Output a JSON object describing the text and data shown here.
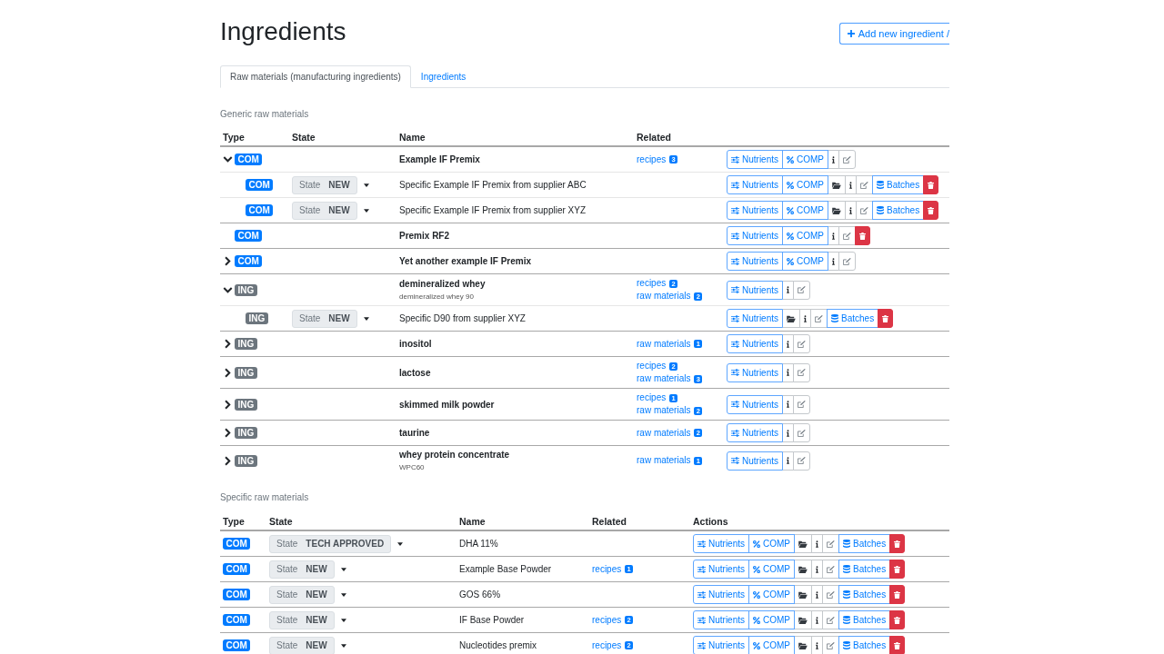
{
  "page": {
    "title": "Ingredients",
    "add_button": "Add new ingredient /"
  },
  "tabs": [
    {
      "label": "Raw materials (manufacturing ingredients)",
      "selected": true
    },
    {
      "label": "Ingredients",
      "selected": false
    }
  ],
  "generic": {
    "title": "Generic raw materials",
    "columns": [
      "Type",
      "State",
      "Name",
      "Related"
    ],
    "rows": [
      {
        "badge": {
          "text": "COM",
          "color": "#007bff"
        },
        "expanded": true,
        "name": "Example IF Premix",
        "related": [
          {
            "label": "recipes",
            "count": "3"
          }
        ],
        "actions": [
          {
            "kind": "nutrients",
            "label": "Nutrients"
          },
          {
            "kind": "comp",
            "label": "COMP"
          },
          {
            "kind": "info"
          },
          {
            "kind": "edit"
          }
        ],
        "children": [
          {
            "badge": {
              "text": "COM",
              "color": "#007bff"
            },
            "state": {
              "label": "State",
              "value": "NEW"
            },
            "name": "Specific Example IF Premix from supplier ABC",
            "actions": [
              {
                "kind": "nutrients",
                "label": "Nutrients"
              },
              {
                "kind": "comp",
                "label": "COMP"
              },
              {
                "kind": "folder"
              },
              {
                "kind": "info"
              },
              {
                "kind": "edit"
              },
              {
                "kind": "batches",
                "label": "Batches"
              },
              {
                "kind": "delete"
              }
            ]
          },
          {
            "badge": {
              "text": "COM",
              "color": "#007bff"
            },
            "state": {
              "label": "State",
              "value": "NEW"
            },
            "name": "Specific Example IF Premix from supplier XYZ",
            "actions": [
              {
                "kind": "nutrients",
                "label": "Nutrients"
              },
              {
                "kind": "comp",
                "label": "COMP"
              },
              {
                "kind": "folder"
              },
              {
                "kind": "info"
              },
              {
                "kind": "edit"
              },
              {
                "kind": "batches",
                "label": "Batches"
              },
              {
                "kind": "delete"
              }
            ]
          }
        ]
      },
      {
        "badge": {
          "text": "COM",
          "color": "#007bff"
        },
        "name": "Premix RF2",
        "actions": [
          {
            "kind": "nutrients",
            "label": "Nutrients"
          },
          {
            "kind": "comp",
            "label": "COMP"
          },
          {
            "kind": "info"
          },
          {
            "kind": "edit"
          },
          {
            "kind": "delete"
          }
        ]
      },
      {
        "badge": {
          "text": "COM",
          "color": "#007bff"
        },
        "expanded": false,
        "name": "Yet another example IF Premix",
        "actions": [
          {
            "kind": "nutrients",
            "label": "Nutrients"
          },
          {
            "kind": "comp",
            "label": "COMP"
          },
          {
            "kind": "info"
          },
          {
            "kind": "edit"
          }
        ]
      },
      {
        "badge": {
          "text": "ING",
          "color": "#6c757d"
        },
        "expanded": true,
        "name": "demineralized whey",
        "note": "demineralized whey 90",
        "related": [
          {
            "label": "recipes",
            "count": "2"
          },
          {
            "label": "raw materials",
            "count": "2"
          }
        ],
        "actions": [
          {
            "kind": "nutrients",
            "label": "Nutrients"
          },
          {
            "kind": "info"
          },
          {
            "kind": "edit"
          }
        ],
        "children": [
          {
            "badge": {
              "text": "ING",
              "color": "#6c757d"
            },
            "state": {
              "label": "State",
              "value": "NEW"
            },
            "name": "Specific D90 from supplier XYZ",
            "actions": [
              {
                "kind": "nutrients",
                "label": "Nutrients"
              },
              {
                "kind": "folder"
              },
              {
                "kind": "info"
              },
              {
                "kind": "edit"
              },
              {
                "kind": "batches",
                "label": "Batches"
              },
              {
                "kind": "delete"
              }
            ]
          }
        ]
      },
      {
        "badge": {
          "text": "ING",
          "color": "#6c757d"
        },
        "expanded": false,
        "name": "inositol",
        "related": [
          {
            "label": "raw materials",
            "count": "1"
          }
        ],
        "actions": [
          {
            "kind": "nutrients",
            "label": "Nutrients"
          },
          {
            "kind": "info"
          },
          {
            "kind": "edit"
          }
        ]
      },
      {
        "badge": {
          "text": "ING",
          "color": "#6c757d"
        },
        "expanded": false,
        "name": "lactose",
        "related": [
          {
            "label": "recipes",
            "count": "2"
          },
          {
            "label": "raw materials",
            "count": "3"
          }
        ],
        "actions": [
          {
            "kind": "nutrients",
            "label": "Nutrients"
          },
          {
            "kind": "info"
          },
          {
            "kind": "edit"
          }
        ]
      },
      {
        "badge": {
          "text": "ING",
          "color": "#6c757d"
        },
        "expanded": false,
        "name": "skimmed milk powder",
        "related": [
          {
            "label": "recipes",
            "count": "1"
          },
          {
            "label": "raw materials",
            "count": "2"
          }
        ],
        "actions": [
          {
            "kind": "nutrients",
            "label": "Nutrients"
          },
          {
            "kind": "info"
          },
          {
            "kind": "edit"
          }
        ]
      },
      {
        "badge": {
          "text": "ING",
          "color": "#6c757d"
        },
        "expanded": false,
        "name": "taurine",
        "related": [
          {
            "label": "raw materials",
            "count": "2"
          }
        ],
        "actions": [
          {
            "kind": "nutrients",
            "label": "Nutrients"
          },
          {
            "kind": "info"
          },
          {
            "kind": "edit"
          }
        ]
      },
      {
        "badge": {
          "text": "ING",
          "color": "#6c757d"
        },
        "expanded": false,
        "name": "whey protein concentrate",
        "note": "WPC60",
        "related": [
          {
            "label": "raw materials",
            "count": "1"
          }
        ],
        "actions": [
          {
            "kind": "nutrients",
            "label": "Nutrients"
          },
          {
            "kind": "info"
          },
          {
            "kind": "edit"
          }
        ]
      }
    ]
  },
  "specific": {
    "title": "Specific raw materials",
    "columns": [
      "Type",
      "State",
      "Name",
      "Related",
      "Actions"
    ],
    "rows": [
      {
        "badge": {
          "text": "COM",
          "color": "#007bff"
        },
        "state": {
          "label": "State",
          "value": "TECH APPROVED"
        },
        "name": "DHA 11%",
        "actions": [
          {
            "kind": "nutrients",
            "label": "Nutrients"
          },
          {
            "kind": "comp",
            "label": "COMP"
          },
          {
            "kind": "folder"
          },
          {
            "kind": "info"
          },
          {
            "kind": "edit"
          },
          {
            "kind": "batches",
            "label": "Batches"
          },
          {
            "kind": "delete"
          }
        ]
      },
      {
        "badge": {
          "text": "COM",
          "color": "#007bff"
        },
        "state": {
          "label": "State",
          "value": "NEW"
        },
        "name": "Example Base Powder",
        "related": [
          {
            "label": "recipes",
            "count": "1"
          }
        ],
        "actions": [
          {
            "kind": "nutrients",
            "label": "Nutrients"
          },
          {
            "kind": "comp",
            "label": "COMP"
          },
          {
            "kind": "folder"
          },
          {
            "kind": "info"
          },
          {
            "kind": "edit"
          },
          {
            "kind": "batches",
            "label": "Batches"
          },
          {
            "kind": "delete"
          }
        ]
      },
      {
        "badge": {
          "text": "COM",
          "color": "#007bff"
        },
        "state": {
          "label": "State",
          "value": "NEW"
        },
        "name": "GOS 66%",
        "actions": [
          {
            "kind": "nutrients",
            "label": "Nutrients"
          },
          {
            "kind": "comp",
            "label": "COMP"
          },
          {
            "kind": "folder"
          },
          {
            "kind": "info"
          },
          {
            "kind": "edit"
          },
          {
            "kind": "batches",
            "label": "Batches"
          },
          {
            "kind": "delete"
          }
        ]
      },
      {
        "badge": {
          "text": "COM",
          "color": "#007bff"
        },
        "state": {
          "label": "State",
          "value": "NEW"
        },
        "name": "IF Base Powder",
        "related": [
          {
            "label": "recipes",
            "count": "2"
          }
        ],
        "actions": [
          {
            "kind": "nutrients",
            "label": "Nutrients"
          },
          {
            "kind": "comp",
            "label": "COMP"
          },
          {
            "kind": "folder"
          },
          {
            "kind": "info"
          },
          {
            "kind": "edit"
          },
          {
            "kind": "batches",
            "label": "Batches"
          },
          {
            "kind": "delete"
          }
        ]
      },
      {
        "badge": {
          "text": "COM",
          "color": "#007bff"
        },
        "state": {
          "label": "State",
          "value": "NEW"
        },
        "name": "Nucleotides premix",
        "related": [
          {
            "label": "recipes",
            "count": "2"
          }
        ],
        "actions": [
          {
            "kind": "nutrients",
            "label": "Nutrients"
          },
          {
            "kind": "comp",
            "label": "COMP"
          },
          {
            "kind": "folder"
          },
          {
            "kind": "info"
          },
          {
            "kind": "edit"
          },
          {
            "kind": "batches",
            "label": "Batches"
          },
          {
            "kind": "delete"
          }
        ]
      }
    ]
  }
}
